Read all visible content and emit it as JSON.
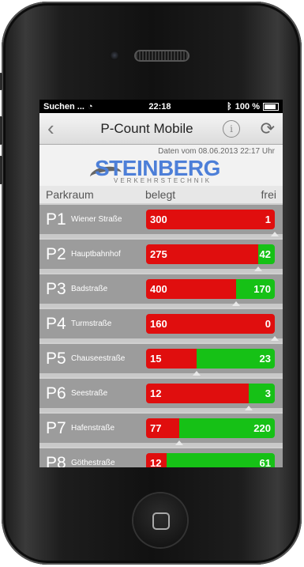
{
  "status": {
    "carrier": "Suchen ...",
    "time": "22:18",
    "battery": "100 %"
  },
  "nav": {
    "title": "P-Count Mobile",
    "back_icon": "chevron-left-icon",
    "info_icon": "info-icon",
    "refresh_icon": "refresh-icon"
  },
  "header": {
    "date_line": "Daten vom  08.06.2013 22:17 Uhr",
    "logo_main": "STEINBERG",
    "logo_sub": "VERKEHRSTECHNIK"
  },
  "columns": {
    "parkraum": "Parkraum",
    "belegt": "belegt",
    "frei": "frei"
  },
  "rows": [
    {
      "id": "P1",
      "name": "Wiener Straße",
      "belegt": "300",
      "frei": "1",
      "fill": 0.997
    },
    {
      "id": "P2",
      "name": "Hauptbahnhof",
      "belegt": "275",
      "frei": "42",
      "fill": 0.87
    },
    {
      "id": "P3",
      "name": "Badstraße",
      "belegt": "400",
      "frei": "170",
      "fill": 0.7
    },
    {
      "id": "P4",
      "name": "Turmstraße",
      "belegt": "160",
      "frei": "0",
      "fill": 1.0
    },
    {
      "id": "P5",
      "name": "Chauseestraße",
      "belegt": "15",
      "frei": "23",
      "fill": 0.39
    },
    {
      "id": "P6",
      "name": "Seestraße",
      "belegt": "12",
      "frei": "3",
      "fill": 0.8
    },
    {
      "id": "P7",
      "name": "Hafenstraße",
      "belegt": "77",
      "frei": "220",
      "fill": 0.26
    },
    {
      "id": "P8",
      "name": "Göthestraße",
      "belegt": "12",
      "frei": "61",
      "fill": 0.16
    }
  ],
  "colors": {
    "occupied": "#e00e0e",
    "free": "#16c116",
    "logo": "#4d7fd8"
  }
}
